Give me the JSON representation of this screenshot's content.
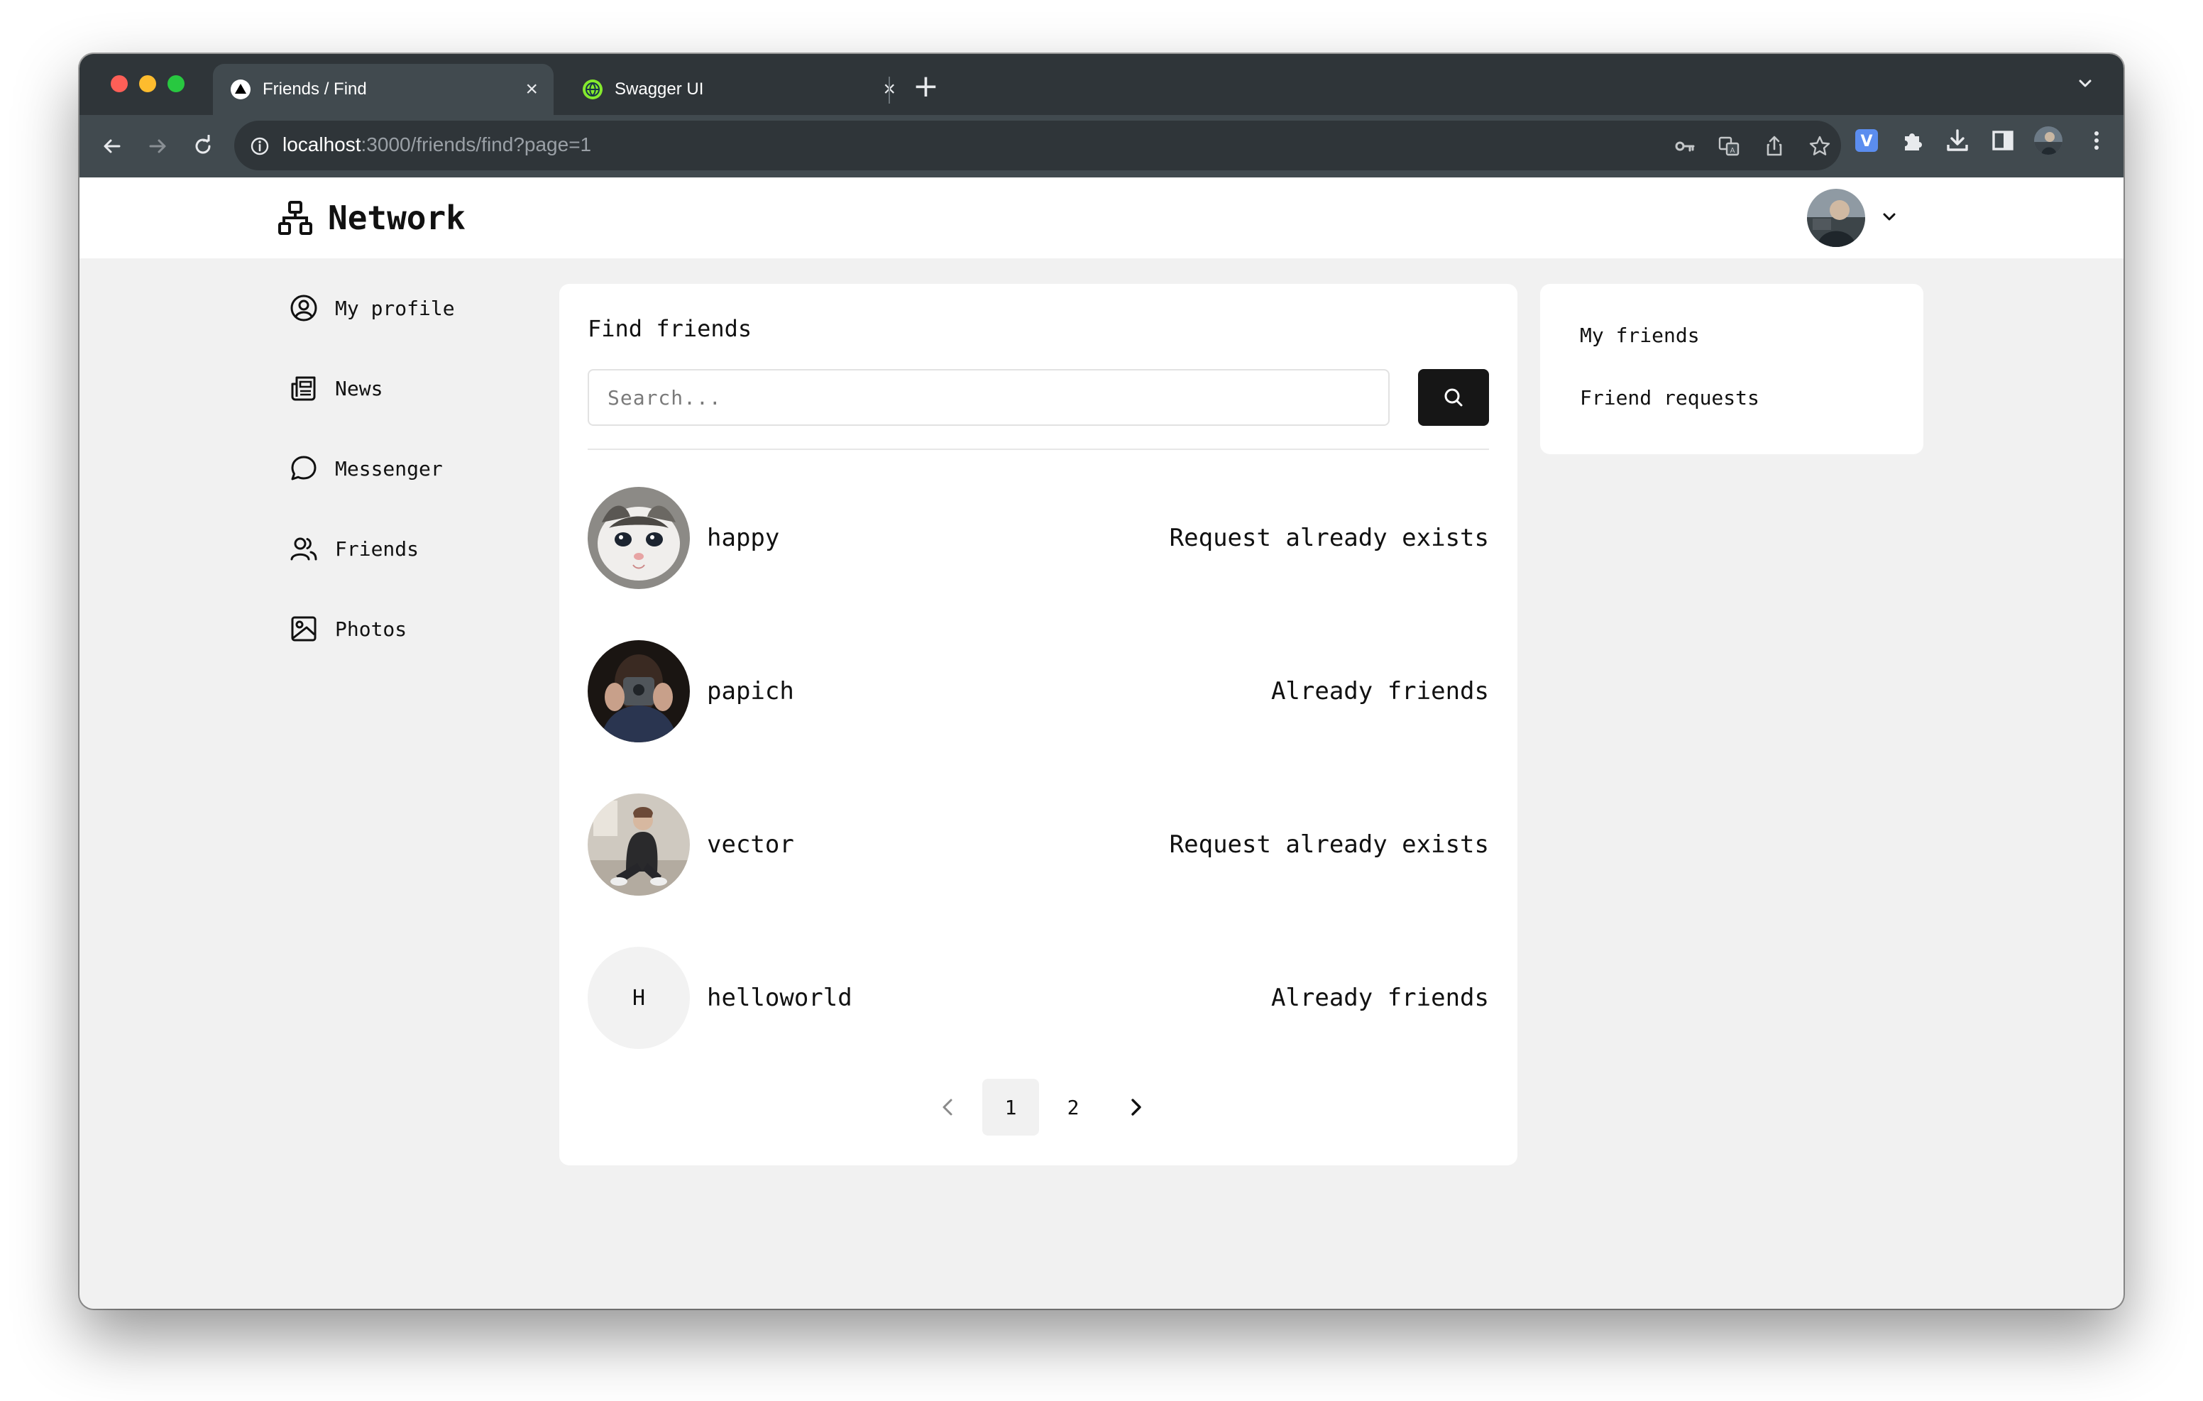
{
  "browser": {
    "tabs": [
      {
        "title": "Friends / Find",
        "icon": "triangle-logo-icon",
        "active": true
      },
      {
        "title": "Swagger UI",
        "icon": "swagger-globe-icon",
        "active": false
      }
    ],
    "url_host": "localhost",
    "url_rest": ":3000/friends/find?page=1"
  },
  "app": {
    "name": "Network"
  },
  "sidebar": {
    "items": [
      {
        "label": "My profile",
        "icon": "user-circle-icon"
      },
      {
        "label": "News",
        "icon": "newspaper-icon"
      },
      {
        "label": "Messenger",
        "icon": "chat-bubble-icon"
      },
      {
        "label": "Friends",
        "icon": "users-icon"
      },
      {
        "label": "Photos",
        "icon": "image-icon"
      }
    ]
  },
  "main": {
    "title": "Find friends",
    "search_placeholder": "Search...",
    "results": [
      {
        "name": "happy",
        "status": "Request already exists",
        "avatar": "photo-kitten"
      },
      {
        "name": "papich",
        "status": "Already friends",
        "avatar": "photo-phone-selfie"
      },
      {
        "name": "vector",
        "status": "Request already exists",
        "avatar": "photo-person-sitting"
      },
      {
        "name": "helloworld",
        "status": "Already friends",
        "avatar_initial": "H"
      }
    ],
    "pagination": {
      "pages": [
        "1",
        "2"
      ],
      "current": "1"
    }
  },
  "right_panel": {
    "links": [
      "My friends",
      "Friend requests"
    ]
  },
  "colors": {
    "chrome_dark": "#2f3539",
    "chrome_toolbar": "#414a4f",
    "page_bg": "#f1f1f1",
    "card_bg": "#ffffff",
    "button_dark": "#161616"
  }
}
